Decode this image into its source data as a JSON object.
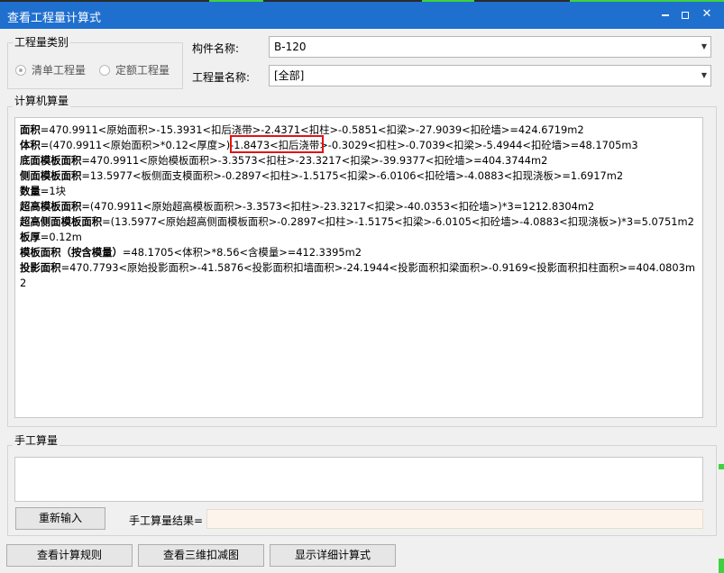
{
  "window": {
    "title": "查看工程量计算式",
    "min_icon": "minimize-icon",
    "max_icon": "maximize-icon",
    "close_glyph": "✕"
  },
  "quantity_type": {
    "group_label": "工程量类别",
    "options": [
      {
        "label": "清单工程量",
        "selected": true
      },
      {
        "label": "定额工程量",
        "selected": false
      }
    ]
  },
  "component": {
    "name_label": "构件名称:",
    "name_value": "B-120",
    "qty_label": "工程量名称:",
    "qty_value": "[全部]"
  },
  "computer_calc": {
    "group_label": "计算机算量",
    "lines": [
      {
        "key": "面积",
        "expr": "=470.9911<原始面积>-15.3931<扣后浇带>-2.4371<扣柱>-0.5851<扣梁>-27.9039<扣砼墙>=424.6719m2"
      },
      {
        "key": "体积",
        "expr": "=(470.9911<原始面积>*0.12<厚度>)-1.8473<扣后浇带>-0.3029<扣柱>-0.7039<扣梁>-5.4944<扣砼墙>=48.1705m3"
      },
      {
        "key": "底面模板面积",
        "expr": "=470.9911<原始模板面积>-3.3573<扣柱>-23.3217<扣梁>-39.9377<扣砼墙>=404.3744m2"
      },
      {
        "key": "侧面模板面积",
        "expr": "=13.5977<板侧面支模面积>-0.2897<扣柱>-1.5175<扣梁>-6.0106<扣砼墙>-4.0883<扣现浇板>=1.6917m2"
      },
      {
        "key": "数量",
        "expr": "=1块"
      },
      {
        "key": "超高模板面积",
        "expr": "=(470.9911<原始超高模板面积>-3.3573<扣柱>-23.3217<扣梁>-40.0353<扣砼墙>)*3=1212.8304m2"
      },
      {
        "key": "超高侧面模板面积",
        "expr": "=(13.5977<原始超高侧面模板面积>-0.2897<扣柱>-1.5175<扣梁>-6.0105<扣砼墙>-4.0883<扣现浇板>)*3=5.0751m2"
      },
      {
        "key": "板厚",
        "expr": "=0.12m"
      },
      {
        "key": "模板面积（按含模量）",
        "expr": "=48.1705<体积>*8.56<含模量>=412.3395m2"
      },
      {
        "key": "投影面积",
        "expr": "=470.7793<原始投影面积>-41.5876<投影面积扣墙面积>-24.1944<投影面积扣梁面积>-0.9169<投影面积扣柱面积>=404.0803m2"
      }
    ]
  },
  "manual_calc": {
    "group_label": "手工算量",
    "reinput_label": "重新输入",
    "result_label": "手工算量结果="
  },
  "footer": {
    "rules_label": "查看计算规则",
    "view3d_label": "查看三维扣减图",
    "detail_label": "显示详细计算式"
  }
}
